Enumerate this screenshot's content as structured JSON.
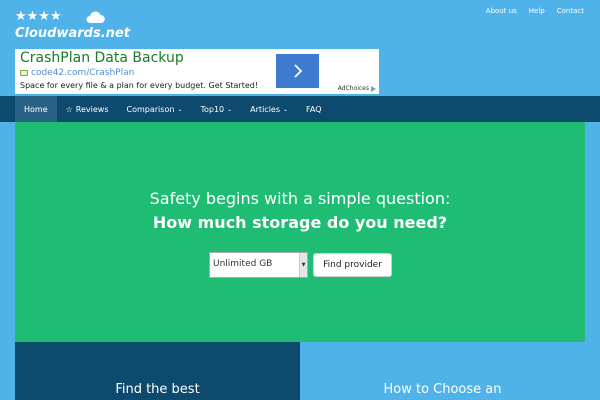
{
  "brand": {
    "name": "Cloudwards.net",
    "stars": "★★★★",
    "white": "#ffffff"
  },
  "top_links": [
    "About us",
    "Help",
    "Contact"
  ],
  "ad": {
    "title": "CrashPlan Data Backup",
    "url": "code42.com/CrashPlan",
    "description": "Space for every file & a plan for every budget. Get Started!",
    "adchoices": "AdChoices",
    "button_icon": "chevron-right-icon",
    "button_color": "#3c7bd0"
  },
  "nav": {
    "items": [
      {
        "label": "Home",
        "icon": "",
        "dropdown": false,
        "active": true
      },
      {
        "label": "Reviews",
        "icon": "☆",
        "dropdown": false,
        "active": false
      },
      {
        "label": "Comparison",
        "icon": "",
        "dropdown": true,
        "active": false
      },
      {
        "label": "Top10",
        "icon": "",
        "dropdown": true,
        "active": false
      },
      {
        "label": "Articles",
        "icon": "",
        "dropdown": true,
        "active": false
      },
      {
        "label": "FAQ",
        "icon": "",
        "dropdown": false,
        "active": false
      }
    ],
    "chevron": "⌄",
    "bg_color": "#0e4a6e"
  },
  "hero": {
    "line1": "Safety begins with a simple question:",
    "line2": "How much storage do you need?",
    "select_value": "Unlimited GB",
    "button_label": "Find provider",
    "bg_color": "#1fbc74"
  },
  "cards": {
    "left_title": "Find the best",
    "right_title": "How to Choose an"
  },
  "colors": {
    "sky": "#4fb3ea",
    "navy": "#0e4a6e",
    "green": "#1fbc74"
  }
}
